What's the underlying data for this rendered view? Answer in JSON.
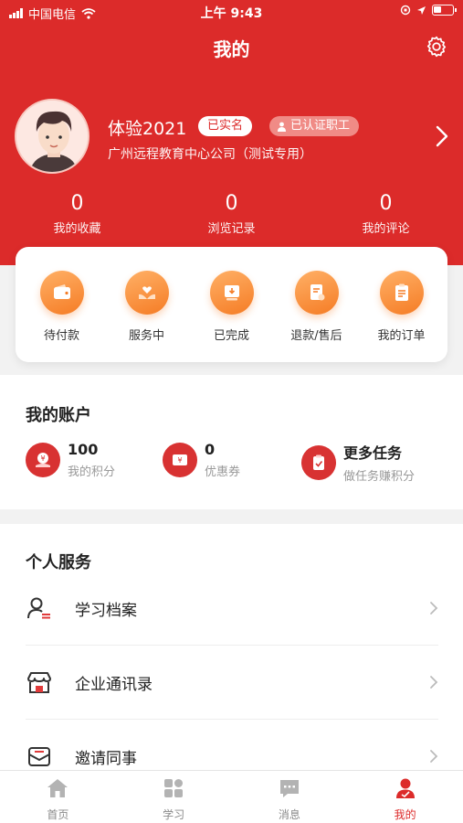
{
  "status_bar": {
    "carrier": "中国电信",
    "time": "上午 9:43"
  },
  "header": {
    "title": "我的"
  },
  "profile": {
    "name": "体验2021",
    "badge_verified": "已实名",
    "badge_staff": "已认证职工",
    "company": "广州远程教育中心公司（测试专用）"
  },
  "stats": [
    {
      "value": "0",
      "label": "我的收藏"
    },
    {
      "value": "0",
      "label": "浏览记录"
    },
    {
      "value": "0",
      "label": "我的评论"
    }
  ],
  "orders": [
    {
      "label": "待付款",
      "icon": "wallet-icon"
    },
    {
      "label": "服务中",
      "icon": "heart-hands-icon"
    },
    {
      "label": "已完成",
      "icon": "completed-box-icon"
    },
    {
      "label": "退款/售后",
      "icon": "refund-doc-icon"
    },
    {
      "label": "我的订单",
      "icon": "order-list-icon"
    }
  ],
  "account": {
    "title": "我的账户",
    "points": {
      "value": "100",
      "label": "我的积分"
    },
    "coupons": {
      "value": "0",
      "label": "优惠券"
    },
    "tasks": {
      "value": "更多任务",
      "label": "做任务赚积分"
    }
  },
  "services": {
    "title": "个人服务",
    "items": [
      {
        "label": "学习档案",
        "icon": "learning-profile-icon"
      },
      {
        "label": "企业通讯录",
        "icon": "store-directory-icon"
      },
      {
        "label": "邀请同事",
        "icon": "invite-mail-icon"
      }
    ]
  },
  "tabs": [
    {
      "label": "首页",
      "icon": "home-icon",
      "active": false
    },
    {
      "label": "学习",
      "icon": "grid-icon",
      "active": false
    },
    {
      "label": "消息",
      "icon": "message-icon",
      "active": false
    },
    {
      "label": "我的",
      "icon": "profile-icon",
      "active": true
    }
  ],
  "colors": {
    "brand_red": "#dc2b2a",
    "order_orange": "#f57c25",
    "tab_inactive": "#8a8a8a"
  }
}
